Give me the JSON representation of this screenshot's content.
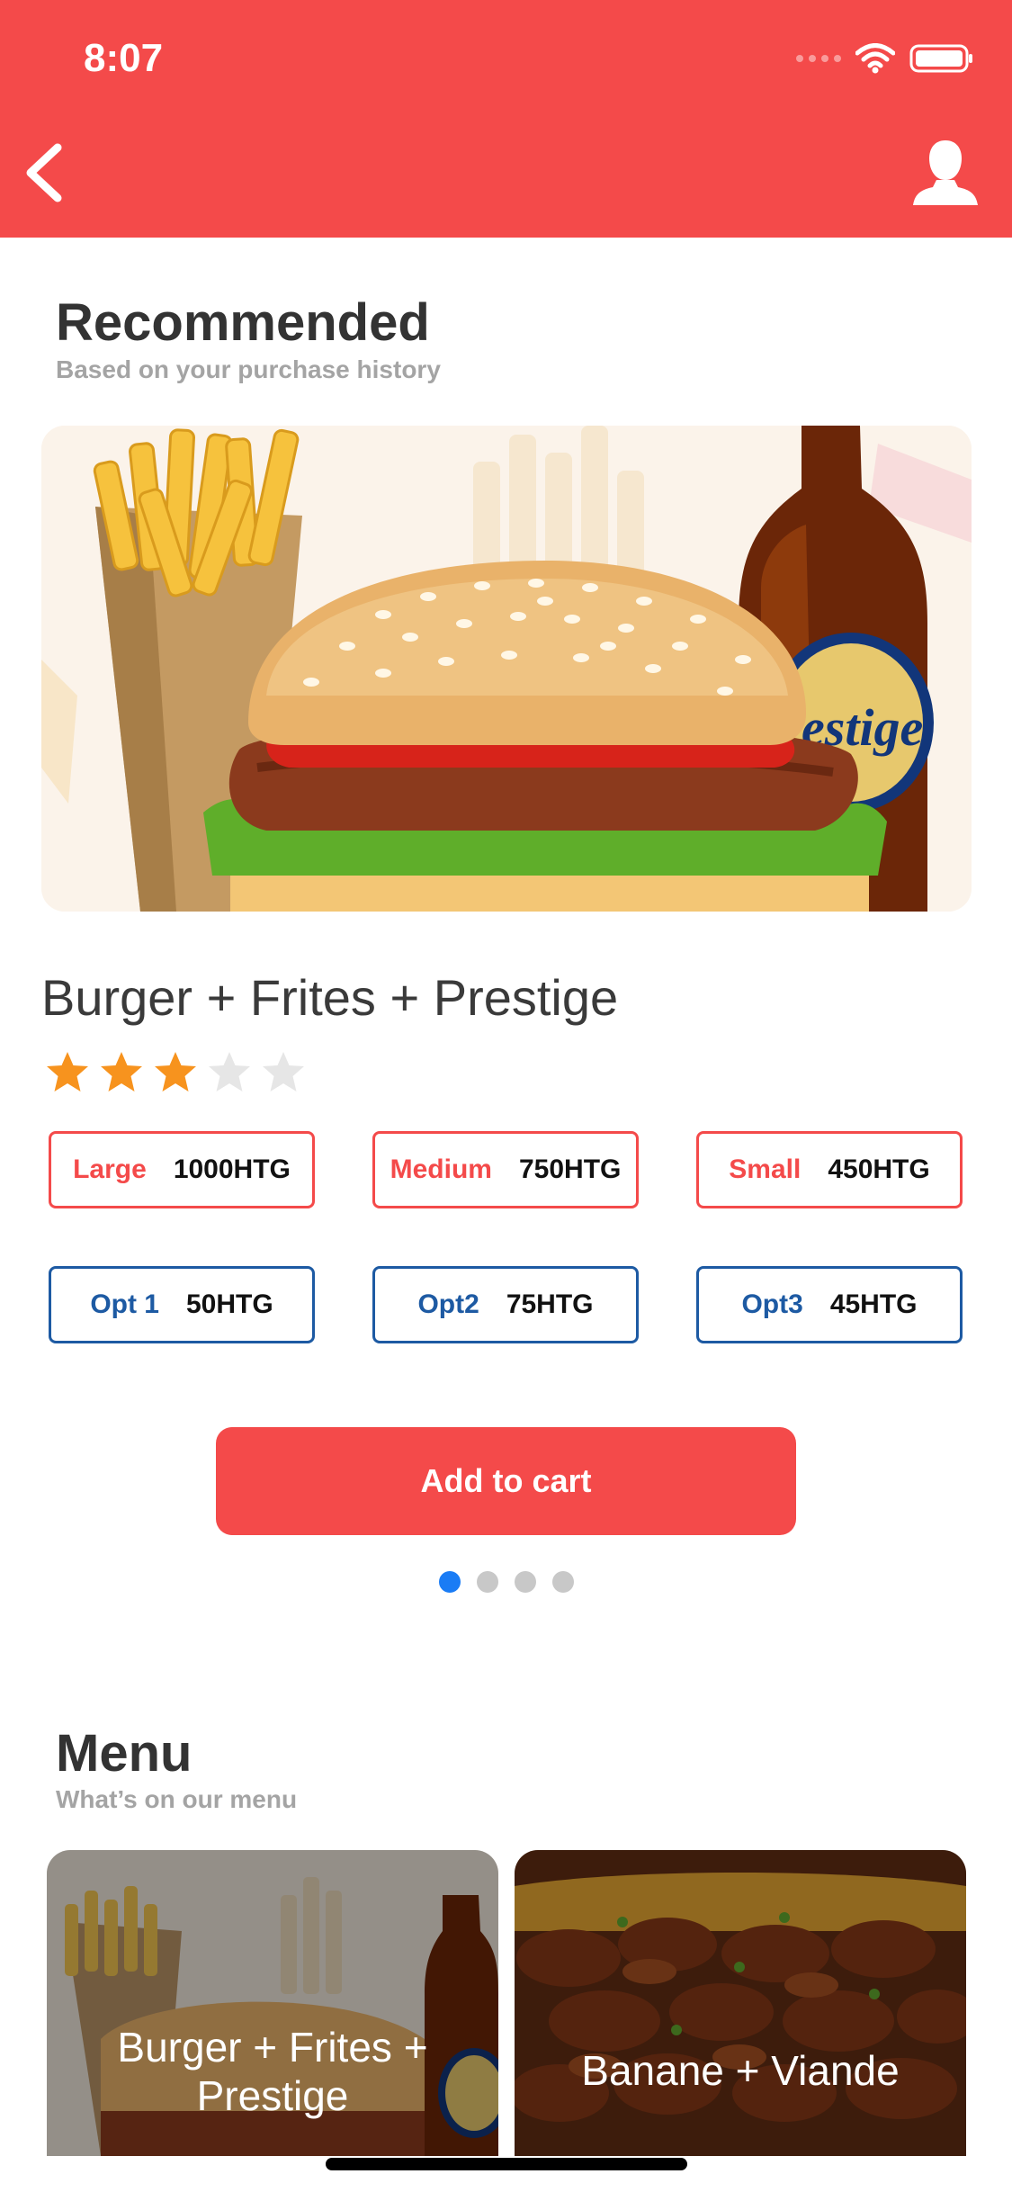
{
  "colors": {
    "accent": "#f44a4a",
    "option_blue": "#1d5aa3",
    "star_on": "#f7931e",
    "star_off": "#e6e6e6",
    "dot_active": "#1a7cf5"
  },
  "status_bar": {
    "time": "8:07",
    "icons": [
      "signal-icon",
      "wifi-icon",
      "battery-icon"
    ]
  },
  "nav": {
    "back_icon": "back-chevron-icon",
    "profile_icon": "user-profile-icon"
  },
  "recommended": {
    "title": "Recommended",
    "subtitle": "Based on your purchase history",
    "product": {
      "name": "Burger + Frites + Prestige",
      "rating": 3,
      "rating_max": 5,
      "sizes": [
        {
          "label": "Large",
          "price": "1000HTG"
        },
        {
          "label": "Medium",
          "price": "750HTG"
        },
        {
          "label": "Small",
          "price": "450HTG"
        }
      ],
      "options": [
        {
          "label": "Opt 1",
          "price": "50HTG"
        },
        {
          "label": "Opt2",
          "price": "75HTG"
        },
        {
          "label": "Opt3",
          "price": "45HTG"
        }
      ],
      "bottle_label": "estige"
    },
    "add_to_cart": "Add to cart",
    "carousel": {
      "pages": 4,
      "active": 0
    }
  },
  "menu": {
    "title": "Menu",
    "subtitle": "What’s on our menu",
    "items": [
      {
        "label": "Burger + Frites + Prestige"
      },
      {
        "label": "Banane + Viande"
      }
    ]
  }
}
